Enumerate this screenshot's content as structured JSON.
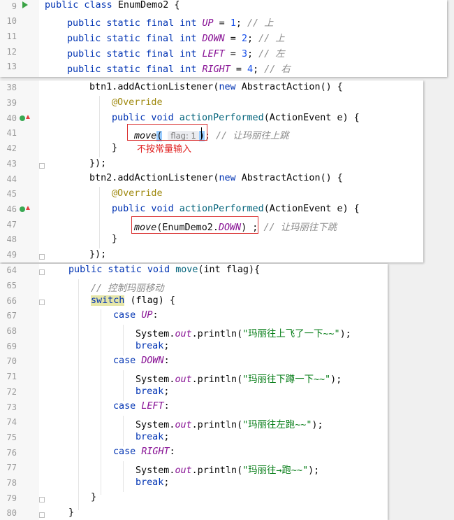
{
  "panel1": {
    "lines": [
      {
        "n": "9"
      },
      {
        "n": "10"
      },
      {
        "n": "11"
      },
      {
        "n": "12"
      },
      {
        "n": "13"
      }
    ],
    "class_name": "EnumDemo2",
    "constants": [
      {
        "name": "UP",
        "value": "1",
        "comment": "// 上"
      },
      {
        "name": "DOWN",
        "value": "2",
        "comment": "// 上"
      },
      {
        "name": "LEFT",
        "value": "3",
        "comment": "// 左"
      },
      {
        "name": "RIGHT",
        "value": "4",
        "comment": "// 右"
      }
    ]
  },
  "panel2": {
    "line_numbers": [
      "38",
      "39",
      "40",
      "41",
      "42",
      "43",
      "44",
      "45",
      "46",
      "47",
      "48",
      "49"
    ],
    "btn1": "btn1",
    "btn2": "btn2",
    "listener": "addActionListener",
    "abstract_action": "AbstractAction",
    "override": "@Override",
    "method": "actionPerformed",
    "event_type": "ActionEvent",
    "param": "e",
    "call1_fn": "move",
    "call1_hint": "flag: 1",
    "call1_comment": "// 让玛丽往上跳",
    "note": "不按常量输入",
    "call2_arg": "EnumDemo2.",
    "call2_field": "DOWN",
    "call2_comment": "// 让玛丽往下跳"
  },
  "panel3": {
    "line_numbers": [
      "64",
      "65",
      "66",
      "67",
      "68",
      "69",
      "70",
      "71",
      "72",
      "73",
      "74",
      "75",
      "76",
      "77",
      "78",
      "79",
      "80"
    ],
    "method_name": "move",
    "param": "int flag",
    "comment": "// 控制玛丽移动",
    "switch_expr": "(flag) {",
    "cases": [
      {
        "label": "UP",
        "message": "\"玛丽往上飞了一下~~\""
      },
      {
        "label": "DOWN",
        "message": "\"玛丽往下蹲一下~~\""
      },
      {
        "label": "LEFT",
        "message": "\"玛丽往左跑~~\""
      },
      {
        "label": "RIGHT",
        "message": "\"玛丽往→跑~~\""
      }
    ],
    "system": "System.",
    "out": "out",
    "println": ".println(",
    "break_kw": "break"
  }
}
